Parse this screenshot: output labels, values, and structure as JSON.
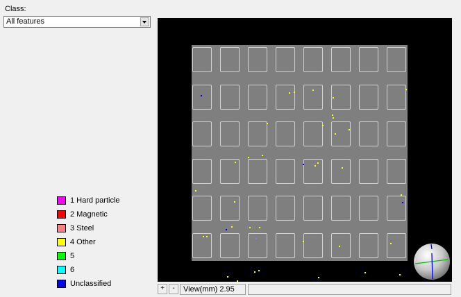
{
  "class_panel": {
    "label": "Class:",
    "selected": "All features"
  },
  "legend": [
    {
      "label": "1 Hard particle",
      "color": "#ff00ff"
    },
    {
      "label": "2 Magnetic",
      "color": "#ff0000"
    },
    {
      "label": "3 Steel",
      "color": "#ff8080"
    },
    {
      "label": "4 Other",
      "color": "#ffff00"
    },
    {
      "label": "5",
      "color": "#00ff00"
    },
    {
      "label": "6",
      "color": "#00ffff"
    },
    {
      "label": "Unclassified",
      "color": "#0000ff"
    }
  ],
  "viewer": {
    "background": "#000000",
    "sample_color": "#7f7f7f",
    "grid": {
      "columns": 8,
      "rows": 6
    },
    "zoom_in_label": "+",
    "zoom_out_label": "-",
    "view_label": "View(mm) 2.95",
    "status": ""
  }
}
